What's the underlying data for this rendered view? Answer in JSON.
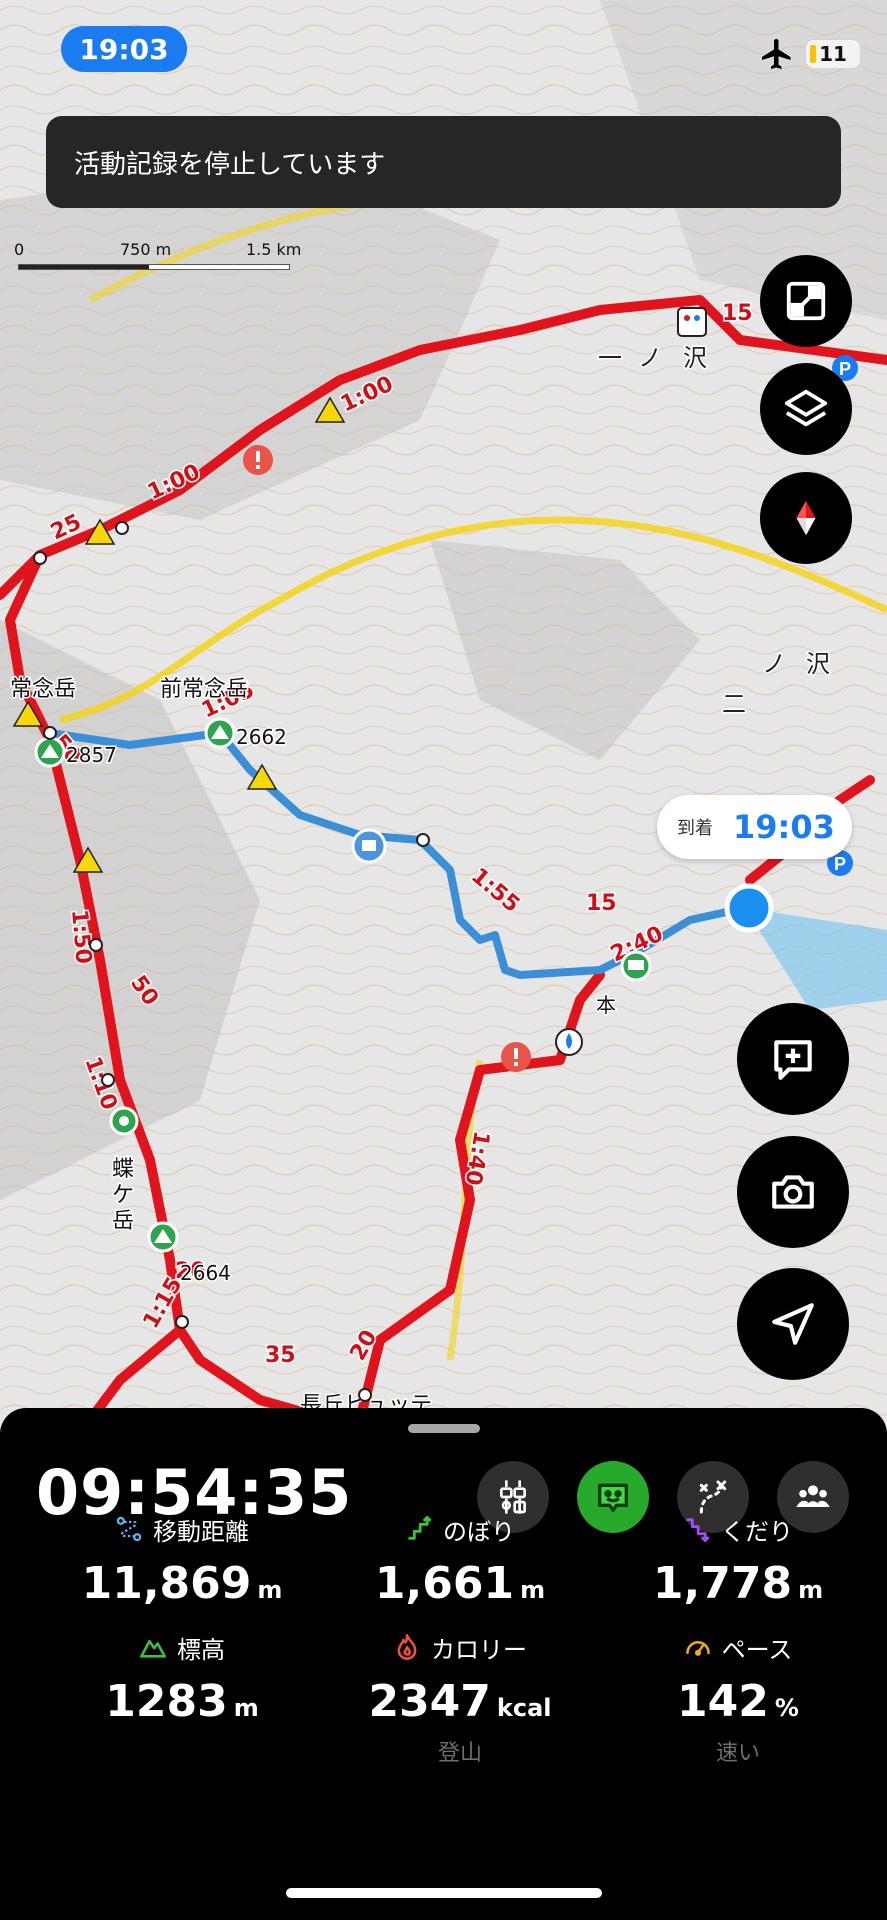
{
  "status_bar": {
    "time": "19:03",
    "battery": "11"
  },
  "toast": {
    "message": "活動記録を停止しています"
  },
  "scale_bar": {
    "labels": [
      "0",
      "750 m",
      "1.5 km"
    ]
  },
  "map": {
    "peak_labels": [
      "常念岳",
      "前常念岳",
      "蝶ケ岳"
    ],
    "elevations": [
      "2857",
      "2662",
      "2664"
    ],
    "course_times": [
      "1:00",
      "1:00",
      "25",
      "1:05",
      "50",
      "1:55",
      "1:50",
      "50",
      "1:10",
      "2:40",
      "15",
      "15",
      "20",
      "1:15",
      "35",
      "20",
      "20",
      "1:40"
    ],
    "valley_labels": [
      "一",
      "ノ",
      "沢",
      "二",
      "ノ",
      "沢"
    ],
    "hut_label": "本",
    "hut_label_partial": "長丘ヒュッテ",
    "arrival": {
      "label": "到着",
      "time": "19:03"
    }
  },
  "buttons": {
    "fullscreen": "fullscreen-icon",
    "layers": "layers-icon",
    "compass": "compass-icon",
    "add_memo": "add-memo-icon",
    "camera": "camera-icon",
    "locate": "location-arrow-icon"
  },
  "panel": {
    "elapsed": "09:54:35",
    "modes": [
      "trail-marker-icon",
      "face-icon",
      "route-icon",
      "group-icon"
    ],
    "stats": [
      {
        "label": "移動距離",
        "value": "11,869",
        "unit": "m",
        "icon": "distance-icon",
        "icon_color": "#5fb3e8"
      },
      {
        "label": "のぼり",
        "value": "1,661",
        "unit": "m",
        "icon": "ascent-icon",
        "icon_color": "#39c23b"
      },
      {
        "label": "くだり",
        "value": "1,778",
        "unit": "m",
        "icon": "descent-icon",
        "icon_color": "#a64df0"
      },
      {
        "label": "標高",
        "value": "1283",
        "unit": "m",
        "icon": "altitude-icon",
        "icon_color": "#39c23b"
      },
      {
        "label": "カロリー",
        "value": "2347",
        "unit": "kcal",
        "sub": "登山",
        "icon": "calorie-icon",
        "icon_color": "#f0503c"
      },
      {
        "label": "ペース",
        "value": "142",
        "unit": "%",
        "sub": "速い",
        "icon": "pace-icon",
        "icon_color": "#f0a81a"
      }
    ]
  },
  "colors": {
    "route_red": "#e0141c",
    "track_blue": "#3b8fd6",
    "boundary_yellow": "#f2d41b",
    "accent_blue": "#1a7cf0",
    "active_green": "#27a92b"
  }
}
